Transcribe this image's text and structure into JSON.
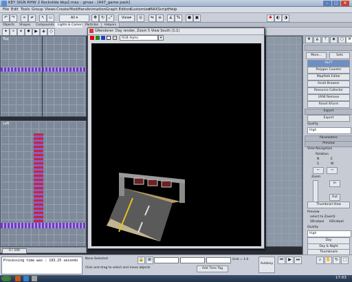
{
  "window": {
    "title": "KEY SIGN RHW 2 Rockslide bkp2.max - gmax - [447_game pack]"
  },
  "menu": [
    "File",
    "Edit",
    "Tools",
    "Group",
    "Views",
    "Create",
    "Modifiers",
    "Animation",
    "Graph Editors",
    "Customize",
    "MAXScript",
    "Help"
  ],
  "tabs": [
    "Objects",
    "Shapes",
    "Compounds",
    "Lights & Cameras",
    "Particles",
    "Helpers"
  ],
  "viewports": {
    "top_label": "Top",
    "left_label": "Left",
    "frame_counter": "0 / 100"
  },
  "render_window": {
    "title": "GRenderer: Day render, Zoom 5 View South (1:1)",
    "channel_select": "RGB Alpha"
  },
  "command_panel": {
    "tab_more": "More...",
    "tab_sets": "Sets",
    "utilities": [
      "GLFT",
      "Polygon Counter",
      "MapPath Editor",
      "Asset Browser",
      "Resource Collector",
      "UVW Remove",
      "Reset XForm"
    ],
    "export_header": "Export",
    "export_button": "Export",
    "quality_label": "Quality",
    "quality_value": "High",
    "parameters_header": "Parameters",
    "preview_header": "Preview",
    "view_navigation_label": "View Navigation",
    "rotation_label": "Rotation",
    "dir_n": "N",
    "dir_e": "E",
    "dir_s": "S",
    "dir_w": "W",
    "zoom_label": "Zoom",
    "zoom_in": "In",
    "zoom_out": "Out",
    "thumbnail_view_button": "Thumbnail View",
    "preview_label": "Preview",
    "preview_select": "select to Zoom5",
    "sd_label": "SDcatpal",
    "hd_label": "HDcatpal",
    "quality2_label": "Quality",
    "quality2_value": "High",
    "day_button": "Day",
    "day_night_button": "Day & Night",
    "thumbnails_button": "Thumbnails"
  },
  "status": {
    "listener": "Processing time was : 193.25 seconds",
    "selection": "None Selected",
    "prompt": "Click and drag to select and move objects",
    "add_time_tag": "Add Time Tag",
    "grid": "Grid = 1.0",
    "autokey": "Autokey"
  },
  "taskbar": {
    "clock": "17:03"
  }
}
